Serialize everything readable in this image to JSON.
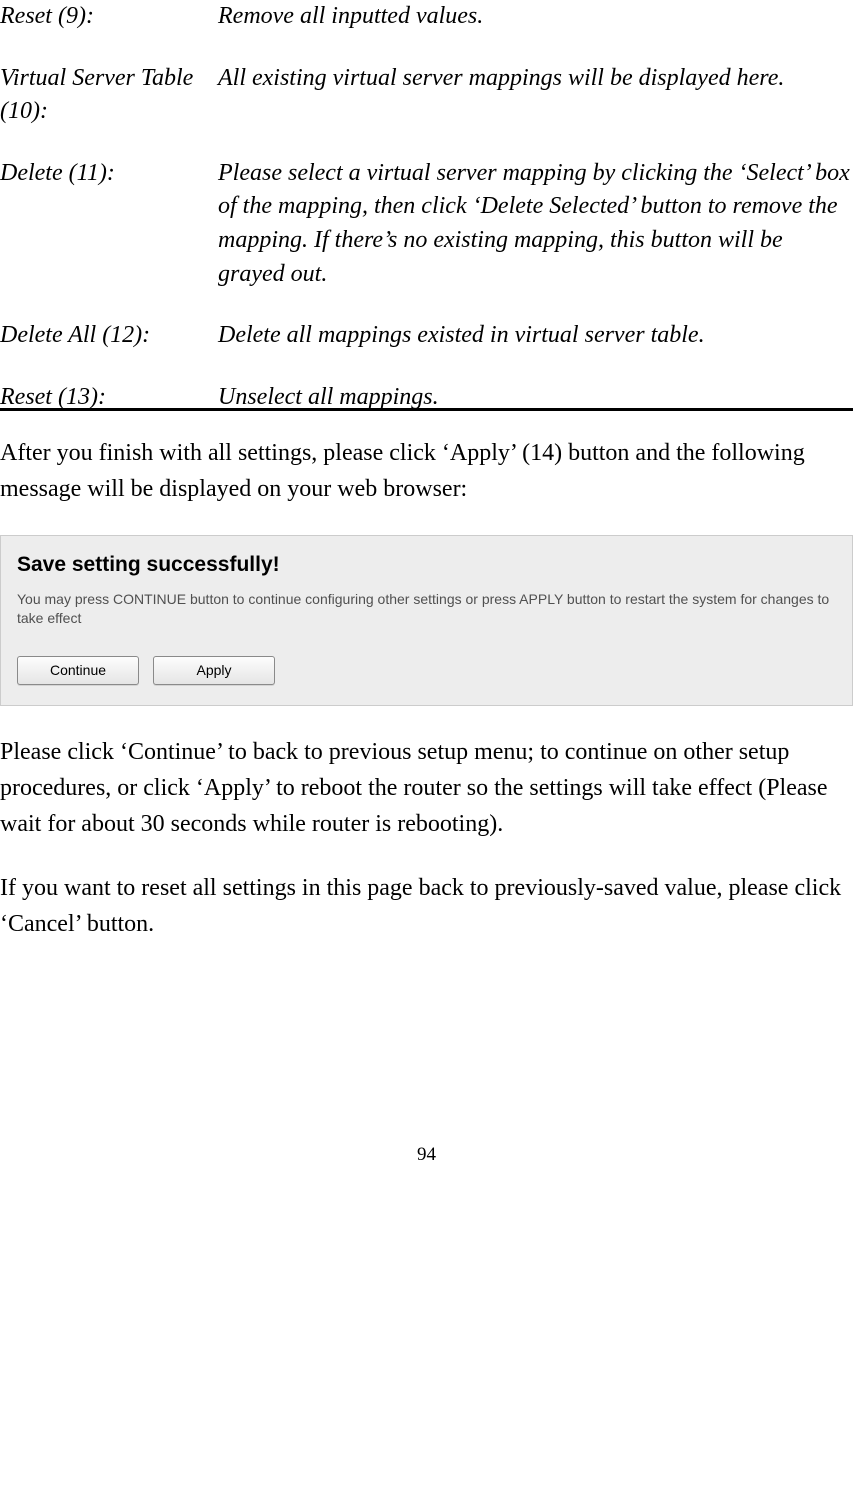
{
  "definitions": [
    {
      "term": "Reset (9):",
      "desc": "Remove all inputted values."
    },
    {
      "term": "Virtual Server Table (10):",
      "desc": "All existing virtual server mappings will be displayed here."
    },
    {
      "term": "Delete (11):",
      "desc": "Please select a virtual server mapping by clicking the ‘Select’ box of the mapping, then click ‘Delete Selected’ button to remove the mapping. If there’s no existing mapping, this button will be grayed out."
    },
    {
      "term": "Delete All (12):",
      "desc": "Delete all mappings existed in virtual server table."
    },
    {
      "term": "Reset (13):",
      "desc": "Unselect all mappings."
    }
  ],
  "paragraph1": "After you finish with all settings, please click ‘Apply’ (14) button and the following message will be displayed on your web browser:",
  "dialog": {
    "title": "Save setting successfully!",
    "text": "You may press CONTINUE button to continue configuring other settings or press APPLY button to restart the system for changes to take effect",
    "continue_label": "Continue",
    "apply_label": "Apply"
  },
  "paragraph2": "Please click ‘Continue’ to back to previous setup menu; to continue on other setup procedures, or click ‘Apply’ to reboot the router so the settings will take effect (Please wait for about 30 seconds while router is rebooting).",
  "paragraph3": "If you want to reset all settings in this page back to previously-saved value, please click ‘Cancel’ button.",
  "page_number": "94"
}
